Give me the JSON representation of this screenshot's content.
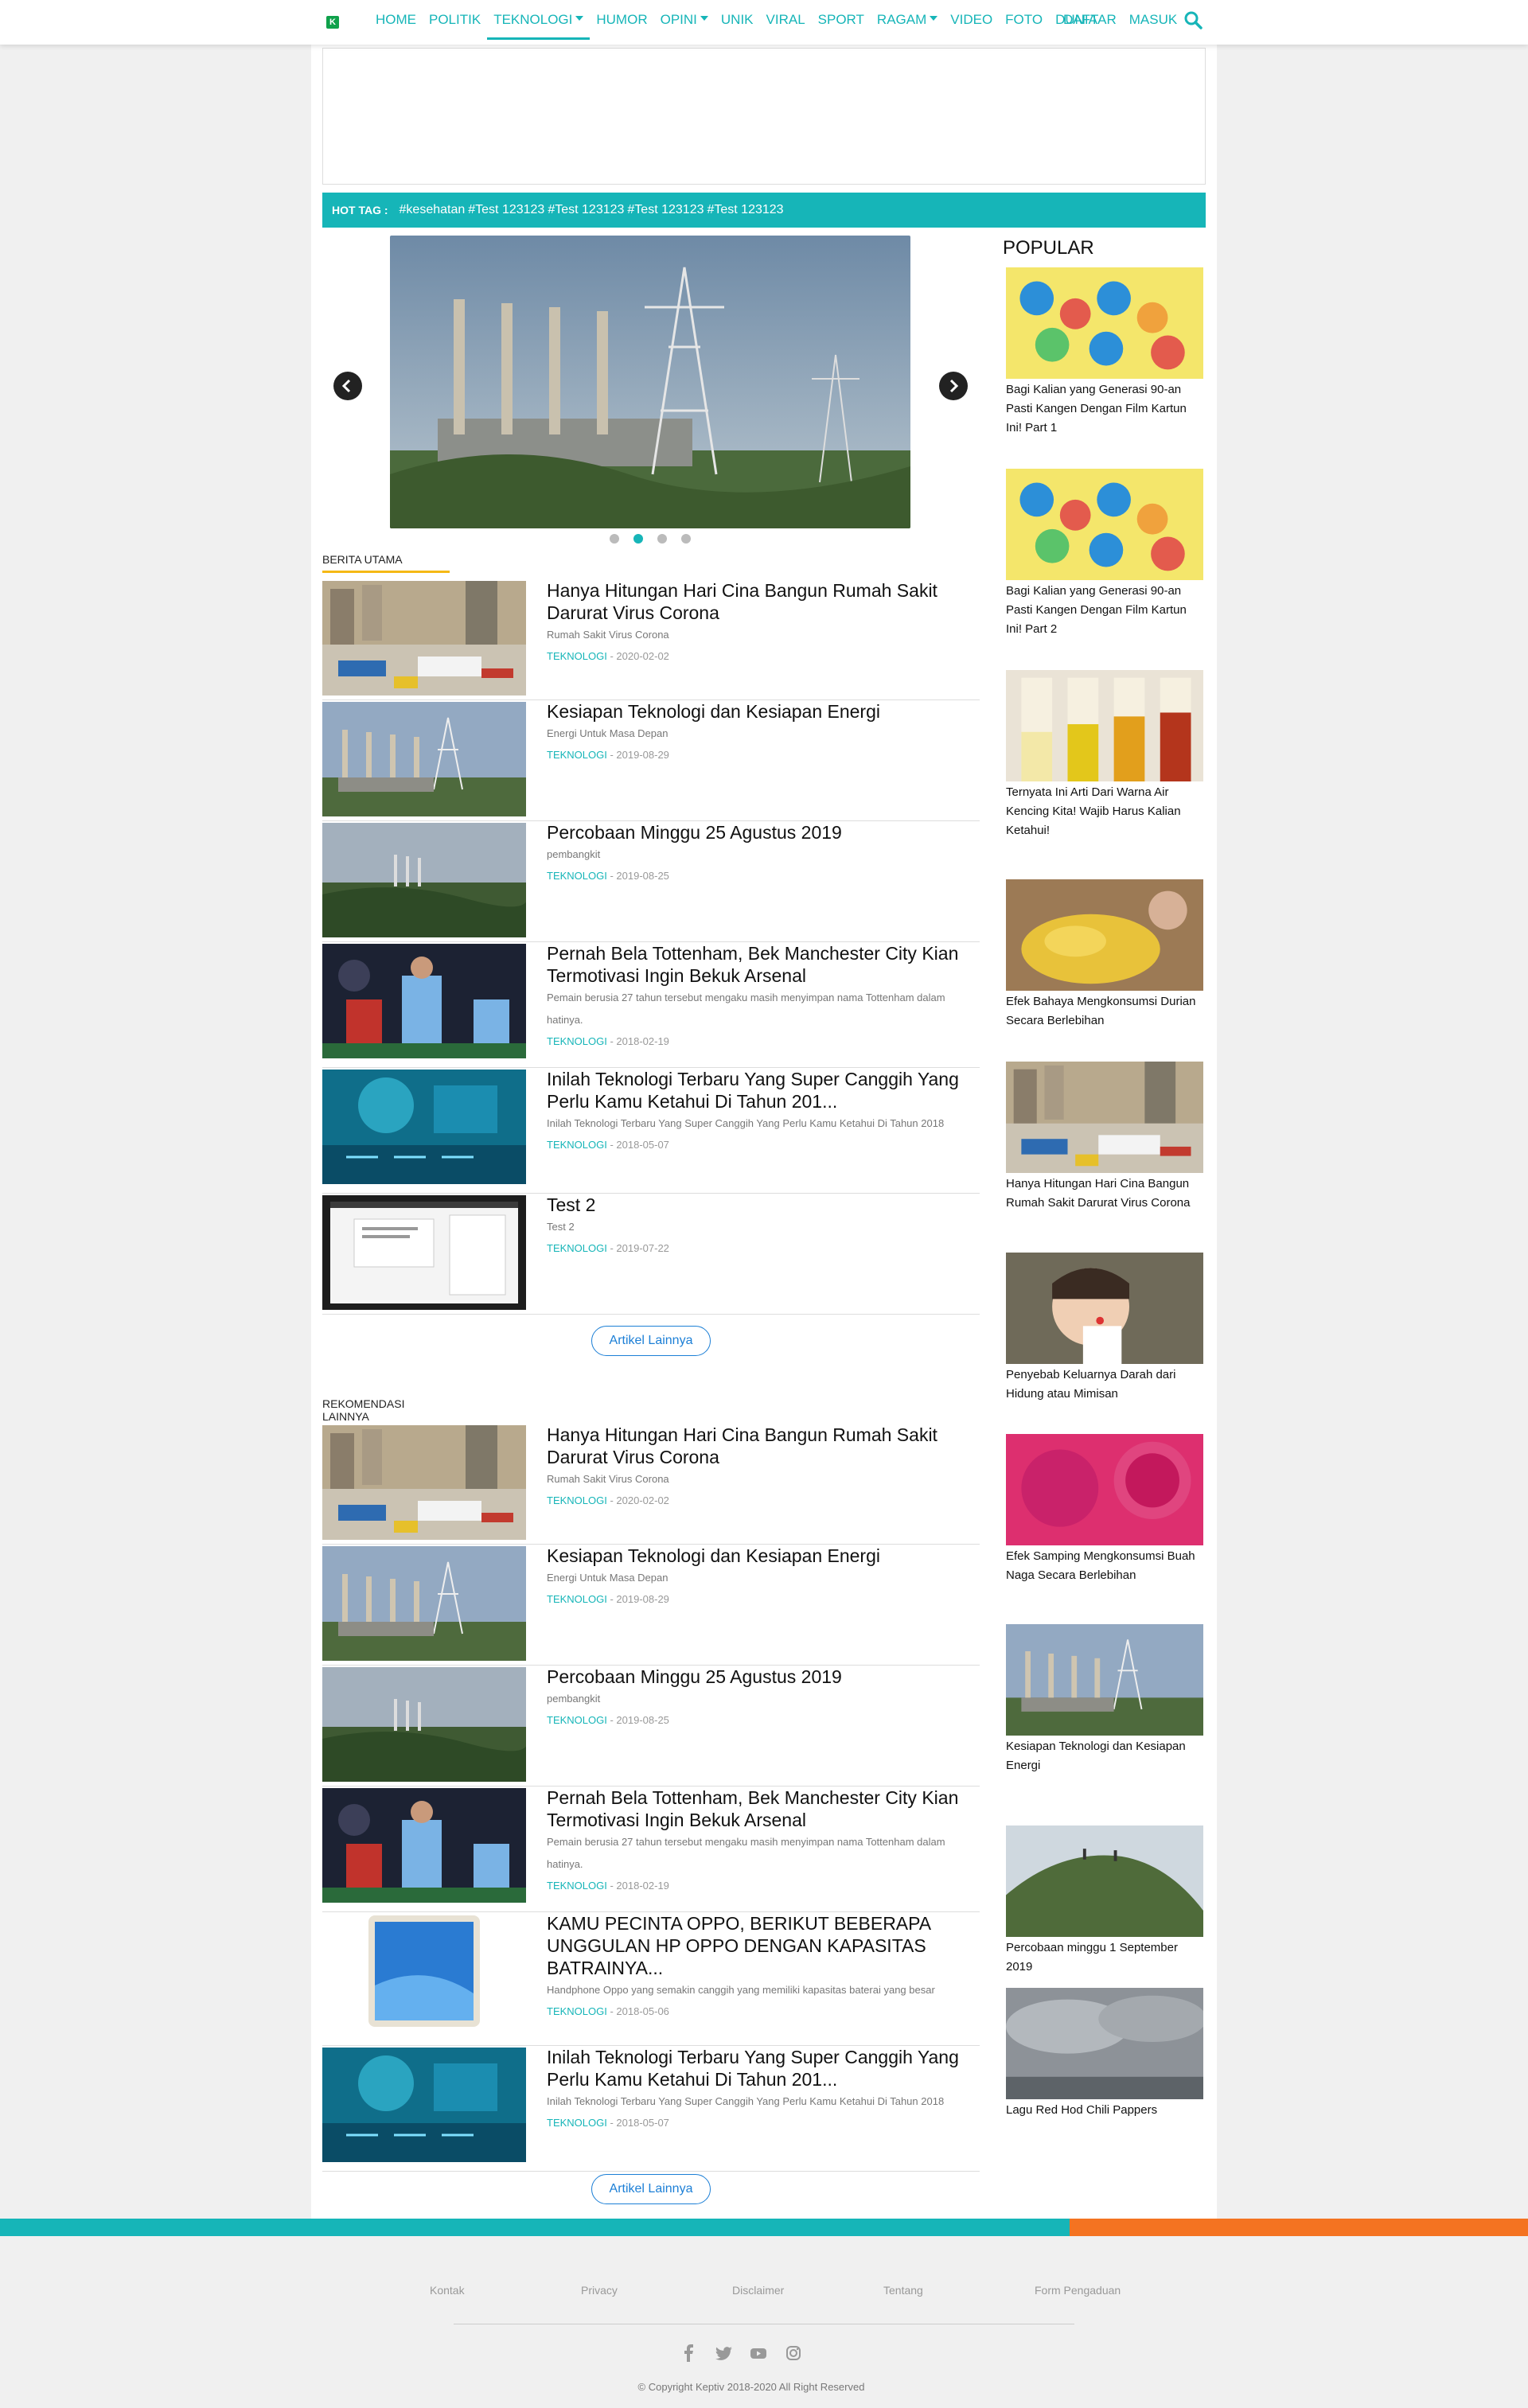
{
  "header": {
    "logo_letter": "K",
    "nav": [
      {
        "label": "HOME"
      },
      {
        "label": "POLITIK"
      },
      {
        "label": "TEKNOLOGI",
        "dropdown": true,
        "active": true
      },
      {
        "label": "HUMOR"
      },
      {
        "label": "OPINI",
        "dropdown": true
      },
      {
        "label": "UNIK"
      },
      {
        "label": "VIRAL"
      },
      {
        "label": "SPORT"
      },
      {
        "label": "RAGAM",
        "dropdown": true
      },
      {
        "label": "VIDEO"
      },
      {
        "label": "FOTO"
      },
      {
        "label": "DUNIA"
      }
    ],
    "register_label": "DAFTAR",
    "login_label": "MASUK",
    "search_icon": "search-icon"
  },
  "hot_tag": {
    "label": "HOT TAG :",
    "tags": [
      "#kesehatan",
      "#Test 123123",
      "#Test 123123",
      "#Test 123123",
      "#Test 123123"
    ]
  },
  "slider": {
    "dots": 4,
    "active_dot": 2
  },
  "berita_utama": {
    "heading": "BERITA UTAMA",
    "articles": [
      {
        "title": "Hanya Hitungan Hari Cina Bangun Rumah Sakit Darurat Virus Corona",
        "summary": "Rumah Sakit Virus Corona",
        "category": "TEKNOLOGI",
        "date": " - 2020-02-02",
        "img": "construction"
      },
      {
        "title": "Kesiapan Teknologi dan Kesiapan Energi",
        "summary": "Energi Untuk Masa Depan",
        "category": "TEKNOLOGI",
        "date": " - 2019-08-29",
        "img": "powerplant"
      },
      {
        "title": "Percobaan Minggu 25 Agustus 2019",
        "summary": "pembangkit",
        "category": "TEKNOLOGI",
        "date": " - 2019-08-25",
        "img": "powerplant-far"
      },
      {
        "title": "Pernah Bela Tottenham, Bek Manchester City Kian Termotivasi Ingin Bekuk Arsenal",
        "summary": "Pemain berusia 27 tahun tersebut mengaku masih menyimpan nama Tottenham dalam hatinya.",
        "category": "TEKNOLOGI",
        "date": " - 2018-02-19",
        "img": "football"
      },
      {
        "title": "Inilah Teknologi Terbaru Yang Super Canggih Yang Perlu Kamu Ketahui Di Tahun 201...",
        "summary": "Inilah Teknologi Terbaru Yang Super Canggih Yang Perlu Kamu Ketahui Di Tahun 2018",
        "category": "TEKNOLOGI",
        "date": " - 2018-05-07",
        "img": "tech"
      },
      {
        "title": "Test 2",
        "summary": "Test 2",
        "category": "TEKNOLOGI",
        "date": " - 2019-07-22",
        "img": "screenshot"
      }
    ],
    "more_label": "Artikel Lainnya"
  },
  "rekomendasi": {
    "heading": "REKOMENDASI LAINNYA",
    "articles": [
      {
        "title": "Hanya Hitungan Hari Cina Bangun Rumah Sakit Darurat Virus Corona",
        "summary": "Rumah Sakit Virus Corona",
        "category": "TEKNOLOGI",
        "date": " - 2020-02-02",
        "img": "construction"
      },
      {
        "title": "Kesiapan Teknologi dan Kesiapan Energi",
        "summary": "Energi Untuk Masa Depan",
        "category": "TEKNOLOGI",
        "date": " - 2019-08-29",
        "img": "powerplant"
      },
      {
        "title": "Percobaan Minggu 25 Agustus 2019",
        "summary": "pembangkit",
        "category": "TEKNOLOGI",
        "date": " - 2019-08-25",
        "img": "powerplant-far"
      },
      {
        "title": "Pernah Bela Tottenham, Bek Manchester City Kian Termotivasi Ingin Bekuk Arsenal",
        "summary": "Pemain berusia 27 tahun tersebut mengaku masih menyimpan nama Tottenham dalam hatinya.",
        "category": "TEKNOLOGI",
        "date": " - 2018-02-19",
        "img": "football"
      },
      {
        "title": "KAMU PECINTA OPPO, BERIKUT BEBERAPA UNGGULAN HP OPPO DENGAN KAPASITAS BATRAINYA...",
        "summary": "Handphone Oppo yang semakin canggih yang memiliki kapasitas baterai yang besar",
        "category": "TEKNOLOGI",
        "date": " - 2018-05-06",
        "img": "phone"
      },
      {
        "title": "Inilah Teknologi Terbaru Yang Super Canggih Yang Perlu Kamu Ketahui Di Tahun 201...",
        "summary": "Inilah Teknologi Terbaru Yang Super Canggih Yang Perlu Kamu Ketahui Di Tahun 2018",
        "category": "TEKNOLOGI",
        "date": " - 2018-05-07",
        "img": "tech"
      }
    ],
    "more_label": "Artikel Lainnya"
  },
  "popular": {
    "heading": "POPULAR",
    "items": [
      {
        "title": "Bagi Kalian yang Generasi 90-an Pasti Kangen Dengan Film Kartun Ini! Part 1",
        "img": "cartoon"
      },
      {
        "title": "Bagi Kalian yang Generasi 90-an Pasti Kangen Dengan Film Kartun Ini! Part 2",
        "img": "cartoon"
      },
      {
        "title": "Ternyata Ini Arti Dari Warna Air Kencing Kita! Wajib Harus Kalian Ketahui!",
        "img": "tubes"
      },
      {
        "title": "Efek Bahaya Mengkonsumsi Durian Secara Berlebihan",
        "img": "durian"
      },
      {
        "title": "Hanya Hitungan Hari Cina Bangun Rumah Sakit Darurat Virus Corona",
        "img": "construction"
      },
      {
        "title": "Penyebab Keluarnya Darah dari Hidung atau Mimisan",
        "img": "girl"
      },
      {
        "title": "Efek Samping Mengkonsumsi Buah Naga Secara Berlebihan",
        "img": "dragonfruit"
      },
      {
        "title": "Kesiapan Teknologi dan Kesiapan Energi",
        "img": "powerplant"
      },
      {
        "title": "Percobaan minggu 1 September 2019",
        "img": "hill"
      },
      {
        "title": "Lagu Red Hod Chili Pappers",
        "img": "clouds"
      }
    ]
  },
  "footer": {
    "links": [
      "Kontak",
      "Privacy",
      "Disclaimer",
      "Tentang",
      "Form Pengaduan"
    ],
    "social": [
      "facebook-icon",
      "twitter-icon",
      "youtube-icon",
      "instagram-icon"
    ],
    "copyright": "© Copyright Keptiv 2018-2020 All Right Reserved"
  }
}
